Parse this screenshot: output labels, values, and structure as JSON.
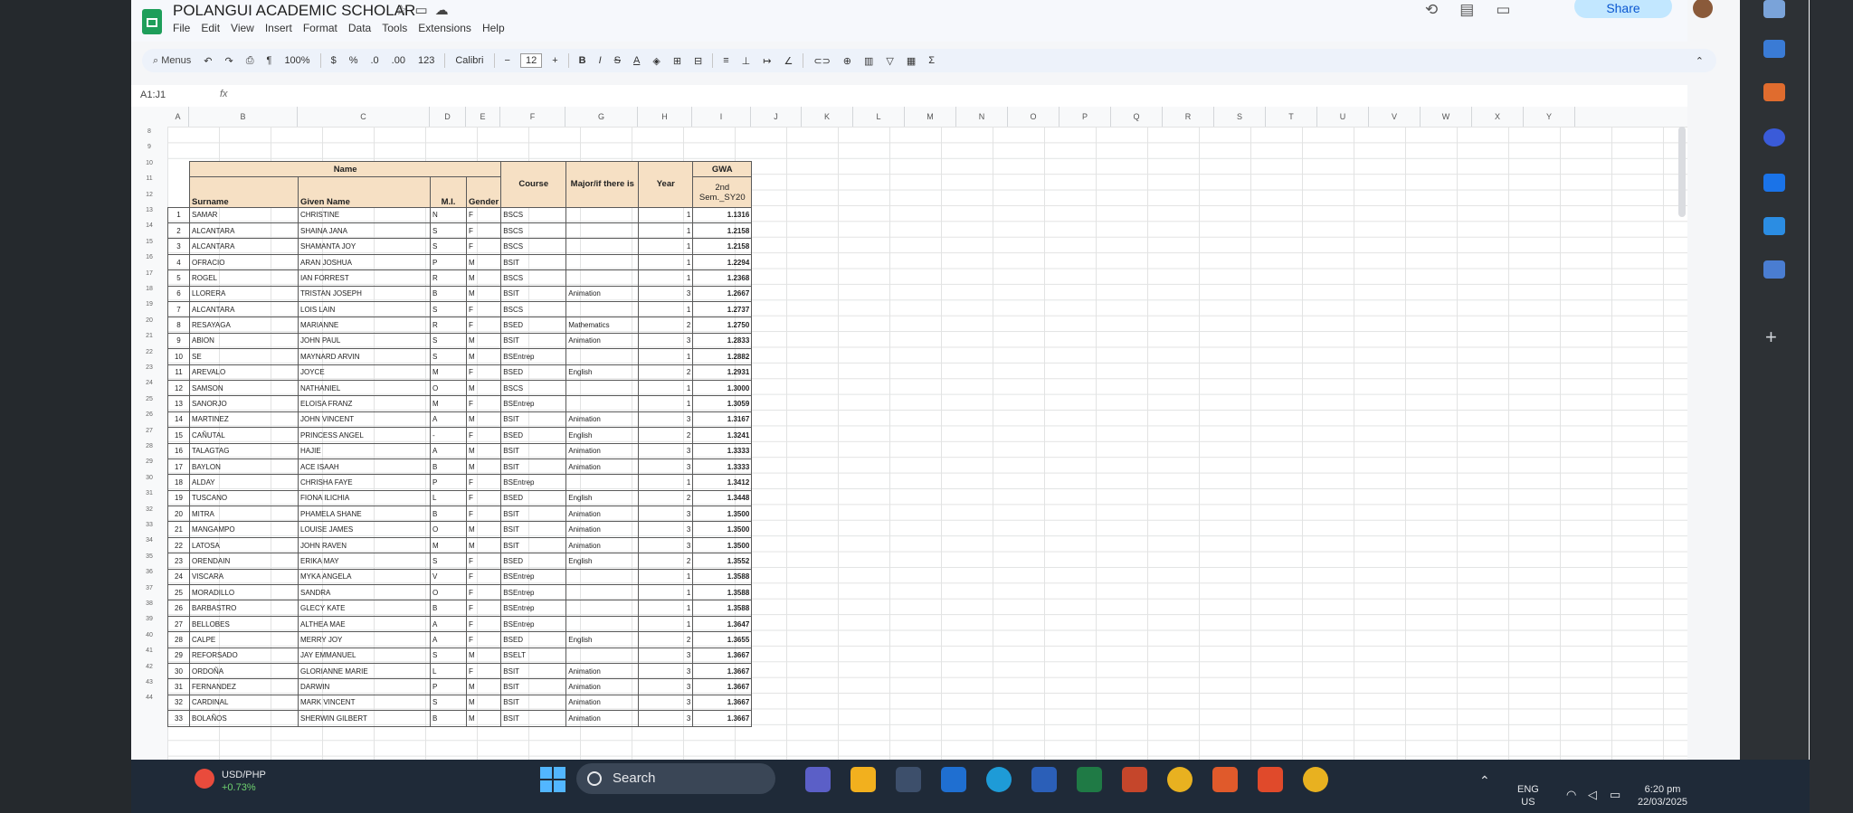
{
  "sheet": {
    "title": "POLANGUI ACADEMIC SCHOLAR",
    "menu": [
      "File",
      "Edit",
      "View",
      "Insert",
      "Format",
      "Data",
      "Tools",
      "Extensions",
      "Help"
    ],
    "share_label": "Share",
    "toolbar": {
      "menus_label": "Menus",
      "zoom": "100%",
      "currency": "$",
      "percent": "%",
      "dec_less": ".0",
      "dec_more": ".00",
      "num_format": "123",
      "font": "Calibri",
      "font_size": "12",
      "minus": "−",
      "plus": "+",
      "bold": "B",
      "italic": "I",
      "strike": "S",
      "textcolor": "A",
      "sigma": "Σ"
    },
    "name_box": "A1:J1",
    "fx": "fx",
    "columns": [
      "A",
      "B",
      "C",
      "D",
      "E",
      "F",
      "G",
      "H",
      "I",
      "J",
      "K",
      "L",
      "M",
      "N",
      "O",
      "P",
      "Q",
      "R",
      "S",
      "T",
      "U",
      "V",
      "W",
      "X",
      "Y"
    ],
    "row_numbers": [
      "8",
      "9",
      "10",
      "11",
      "12",
      "13",
      "14",
      "15",
      "16",
      "17",
      "18",
      "19",
      "20",
      "21",
      "22",
      "23",
      "24",
      "25",
      "26",
      "27",
      "28",
      "29",
      "30",
      "31",
      "32",
      "33",
      "34",
      "35",
      "36",
      "37",
      "38",
      "39",
      "40",
      "41",
      "42",
      "43",
      "44"
    ],
    "header": {
      "name": "Name",
      "surname": "Surname",
      "given": "Given Name",
      "mi": "M.I.",
      "gender": "Gender",
      "course": "Course",
      "major": "Major/if there is",
      "year": "Year",
      "gwa": "GWA",
      "gwa_sub": "2nd Sem._SY20"
    },
    "rows": [
      {
        "n": "1",
        "surname": "SAMAR",
        "given": "CHRISTINE",
        "mi": "N",
        "g": "F",
        "course": "BSCS",
        "major": "",
        "year": "1",
        "gwa": "1.1316"
      },
      {
        "n": "2",
        "surname": "ALCANTARA",
        "given": "SHAINA JANA",
        "mi": "S",
        "g": "F",
        "course": "BSCS",
        "major": "",
        "year": "1",
        "gwa": "1.2158"
      },
      {
        "n": "3",
        "surname": "ALCANTARA",
        "given": "SHAMANTA JOY",
        "mi": "S",
        "g": "F",
        "course": "BSCS",
        "major": "",
        "year": "1",
        "gwa": "1.2158"
      },
      {
        "n": "4",
        "surname": "OFRACIO",
        "given": "ARAN JOSHUA",
        "mi": "P",
        "g": "M",
        "course": "BSIT",
        "major": "",
        "year": "1",
        "gwa": "1.2294"
      },
      {
        "n": "5",
        "surname": "ROGEL",
        "given": "IAN FORREST",
        "mi": "R",
        "g": "M",
        "course": "BSCS",
        "major": "",
        "year": "1",
        "gwa": "1.2368"
      },
      {
        "n": "6",
        "surname": "LLORERA",
        "given": "TRISTAN JOSEPH",
        "mi": "B",
        "g": "M",
        "course": "BSIT",
        "major": "Animation",
        "year": "3",
        "gwa": "1.2667"
      },
      {
        "n": "7",
        "surname": "ALCANTARA",
        "given": "LOIS LAIN",
        "mi": "S",
        "g": "F",
        "course": "BSCS",
        "major": "",
        "year": "1",
        "gwa": "1.2737"
      },
      {
        "n": "8",
        "surname": "RESAYAGA",
        "given": "MARIANNE",
        "mi": "R",
        "g": "F",
        "course": "BSED",
        "major": "Mathematics",
        "year": "2",
        "gwa": "1.2750"
      },
      {
        "n": "9",
        "surname": "ABION",
        "given": "JOHN PAUL",
        "mi": "S",
        "g": "M",
        "course": "BSIT",
        "major": "Animation",
        "year": "3",
        "gwa": "1.2833"
      },
      {
        "n": "10",
        "surname": "SE",
        "given": "MAYNARD ARVIN",
        "mi": "S",
        "g": "M",
        "course": "BSEntrep",
        "major": "",
        "year": "1",
        "gwa": "1.2882"
      },
      {
        "n": "11",
        "surname": "AREVALO",
        "given": "JOYCE",
        "mi": "M",
        "g": "F",
        "course": "BSED",
        "major": "English",
        "year": "2",
        "gwa": "1.2931"
      },
      {
        "n": "12",
        "surname": "SAMSON",
        "given": "NATHANIEL",
        "mi": "O",
        "g": "M",
        "course": "BSCS",
        "major": "",
        "year": "1",
        "gwa": "1.3000"
      },
      {
        "n": "13",
        "surname": "SANORJO",
        "given": "ELOISA FRANZ",
        "mi": "M",
        "g": "F",
        "course": "BSEntrep",
        "major": "",
        "year": "1",
        "gwa": "1.3059"
      },
      {
        "n": "14",
        "surname": "MARTINEZ",
        "given": "JOHN VINCENT",
        "mi": "A",
        "g": "M",
        "course": "BSIT",
        "major": "Animation",
        "year": "3",
        "gwa": "1.3167"
      },
      {
        "n": "15",
        "surname": "CAÑUTAL",
        "given": "PRINCESS ANGEL",
        "mi": "-",
        "g": "F",
        "course": "BSED",
        "major": "English",
        "year": "2",
        "gwa": "1.3241"
      },
      {
        "n": "16",
        "surname": "TALAGTAG",
        "given": "HAJIE",
        "mi": "A",
        "g": "M",
        "course": "BSIT",
        "major": "Animation",
        "year": "3",
        "gwa": "1.3333"
      },
      {
        "n": "17",
        "surname": "BAYLON",
        "given": "ACE ISAAH",
        "mi": "B",
        "g": "M",
        "course": "BSIT",
        "major": "Animation",
        "year": "3",
        "gwa": "1.3333"
      },
      {
        "n": "18",
        "surname": "ALDAY",
        "given": "CHRISHA FAYE",
        "mi": "P",
        "g": "F",
        "course": "BSEntrep",
        "major": "",
        "year": "1",
        "gwa": "1.3412"
      },
      {
        "n": "19",
        "surname": "TUSCANO",
        "given": "FIONA ILICHIA",
        "mi": "L",
        "g": "F",
        "course": "BSED",
        "major": "English",
        "year": "2",
        "gwa": "1.3448"
      },
      {
        "n": "20",
        "surname": "MITRA",
        "given": "PHAMELA SHANE",
        "mi": "B",
        "g": "F",
        "course": "BSIT",
        "major": "Animation",
        "year": "3",
        "gwa": "1.3500"
      },
      {
        "n": "21",
        "surname": "MANGAMPO",
        "given": "LOUISE JAMES",
        "mi": "O",
        "g": "M",
        "course": "BSIT",
        "major": "Animation",
        "year": "3",
        "gwa": "1.3500"
      },
      {
        "n": "22",
        "surname": "LATOSA",
        "given": "JOHN RAVEN",
        "mi": "M",
        "g": "M",
        "course": "BSIT",
        "major": "Animation",
        "year": "3",
        "gwa": "1.3500"
      },
      {
        "n": "23",
        "surname": "ORENDAIN",
        "given": "ERIKA MAY",
        "mi": "S",
        "g": "F",
        "course": "BSED",
        "major": "English",
        "year": "2",
        "gwa": "1.3552"
      },
      {
        "n": "24",
        "surname": "VISCARA",
        "given": "MYKA ANGELA",
        "mi": "V",
        "g": "F",
        "course": "BSEntrep",
        "major": "",
        "year": "1",
        "gwa": "1.3588"
      },
      {
        "n": "25",
        "surname": "MORADILLO",
        "given": "SANDRA",
        "mi": "O",
        "g": "F",
        "course": "BSEntrep",
        "major": "",
        "year": "1",
        "gwa": "1.3588"
      },
      {
        "n": "26",
        "surname": "BARBASTRO",
        "given": "GLECY KATE",
        "mi": "B",
        "g": "F",
        "course": "BSEntrep",
        "major": "",
        "year": "1",
        "gwa": "1.3588"
      },
      {
        "n": "27",
        "surname": "BELLOBES",
        "given": "ALTHEA MAE",
        "mi": "A",
        "g": "F",
        "course": "BSEntrep",
        "major": "",
        "year": "1",
        "gwa": "1.3647"
      },
      {
        "n": "28",
        "surname": "CALPE",
        "given": "MERRY JOY",
        "mi": "A",
        "g": "F",
        "course": "BSED",
        "major": "English",
        "year": "2",
        "gwa": "1.3655"
      },
      {
        "n": "29",
        "surname": "REFORSADO",
        "given": "JAY EMMANUEL",
        "mi": "S",
        "g": "M",
        "course": "BSELT",
        "major": "",
        "year": "3",
        "gwa": "1.3667"
      },
      {
        "n": "30",
        "surname": "ORDOÑA",
        "given": "GLORIANNE MARIE",
        "mi": "L",
        "g": "F",
        "course": "BSIT",
        "major": "Animation",
        "year": "3",
        "gwa": "1.3667"
      },
      {
        "n": "31",
        "surname": "FERNANDEZ",
        "given": "DARWIN",
        "mi": "P",
        "g": "M",
        "course": "BSIT",
        "major": "Animation",
        "year": "3",
        "gwa": "1.3667"
      },
      {
        "n": "32",
        "surname": "CARDINAL",
        "given": "MARK VINCENT",
        "mi": "S",
        "g": "M",
        "course": "BSIT",
        "major": "Animation",
        "year": "3",
        "gwa": "1.3667"
      },
      {
        "n": "33",
        "surname": "BOLAÑOS",
        "given": "SHERWIN GILBERT",
        "mi": "B",
        "g": "M",
        "course": "BSIT",
        "major": "Animation",
        "year": "3",
        "gwa": "1.3667"
      }
    ]
  },
  "taskbar": {
    "stock_label": "USD/PHP",
    "stock_change": "+0.73%",
    "search_label": "Search",
    "lang_top": "ENG",
    "lang_bottom": "US",
    "time": "6:20 pm",
    "date": "22/03/2025"
  },
  "colors": {
    "header_fill": "#f6e0c4",
    "sheets_green": "#1e9e5a",
    "share_bg": "#c2e7ff",
    "taskbar_bg": "#1f2a38"
  }
}
